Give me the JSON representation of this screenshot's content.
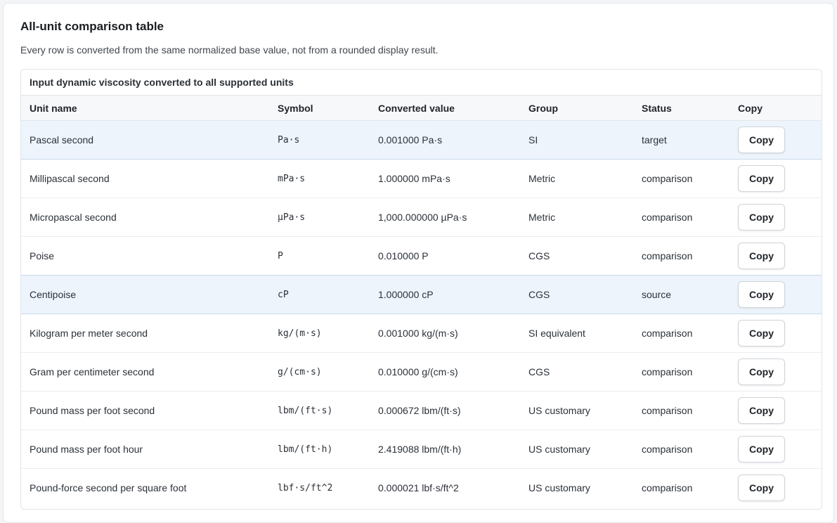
{
  "section": {
    "title": "All-unit comparison table",
    "subtitle": "Every row is converted from the same normalized base value, not from a rounded display result."
  },
  "table": {
    "caption": "Input dynamic viscosity converted to all supported units",
    "headers": {
      "unit_name": "Unit name",
      "symbol": "Symbol",
      "converted_value": "Converted value",
      "group": "Group",
      "status": "Status",
      "copy": "Copy"
    },
    "highlight_color": "#edf4fc",
    "rows": [
      {
        "name": "Pascal second",
        "symbol": "Pa·s",
        "value": "0.001000 Pa·s",
        "group": "SI",
        "status": "target",
        "copy_label": "Copy"
      },
      {
        "name": "Millipascal second",
        "symbol": "mPa·s",
        "value": "1.000000 mPa·s",
        "group": "Metric",
        "status": "comparison",
        "copy_label": "Copy"
      },
      {
        "name": "Micropascal second",
        "symbol": "µPa·s",
        "value": "1,000.000000 µPa·s",
        "group": "Metric",
        "status": "comparison",
        "copy_label": "Copy"
      },
      {
        "name": "Poise",
        "symbol": "P",
        "value": "0.010000 P",
        "group": "CGS",
        "status": "comparison",
        "copy_label": "Copy"
      },
      {
        "name": "Centipoise",
        "symbol": "cP",
        "value": "1.000000 cP",
        "group": "CGS",
        "status": "source",
        "copy_label": "Copy"
      },
      {
        "name": "Kilogram per meter second",
        "symbol": "kg/(m·s)",
        "value": "0.001000 kg/(m·s)",
        "group": "SI equivalent",
        "status": "comparison",
        "copy_label": "Copy"
      },
      {
        "name": "Gram per centimeter second",
        "symbol": "g/(cm·s)",
        "value": "0.010000 g/(cm·s)",
        "group": "CGS",
        "status": "comparison",
        "copy_label": "Copy"
      },
      {
        "name": "Pound mass per foot second",
        "symbol": "lbm/(ft·s)",
        "value": "0.000672 lbm/(ft·s)",
        "group": "US customary",
        "status": "comparison",
        "copy_label": "Copy"
      },
      {
        "name": "Pound mass per foot hour",
        "symbol": "lbm/(ft·h)",
        "value": "2.419088 lbm/(ft·h)",
        "group": "US customary",
        "status": "comparison",
        "copy_label": "Copy"
      },
      {
        "name": "Pound-force second per square foot",
        "symbol": "lbf·s/ft^2",
        "value": "0.000021 lbf·s/ft^2",
        "group": "US customary",
        "status": "comparison",
        "copy_label": "Copy"
      }
    ]
  }
}
